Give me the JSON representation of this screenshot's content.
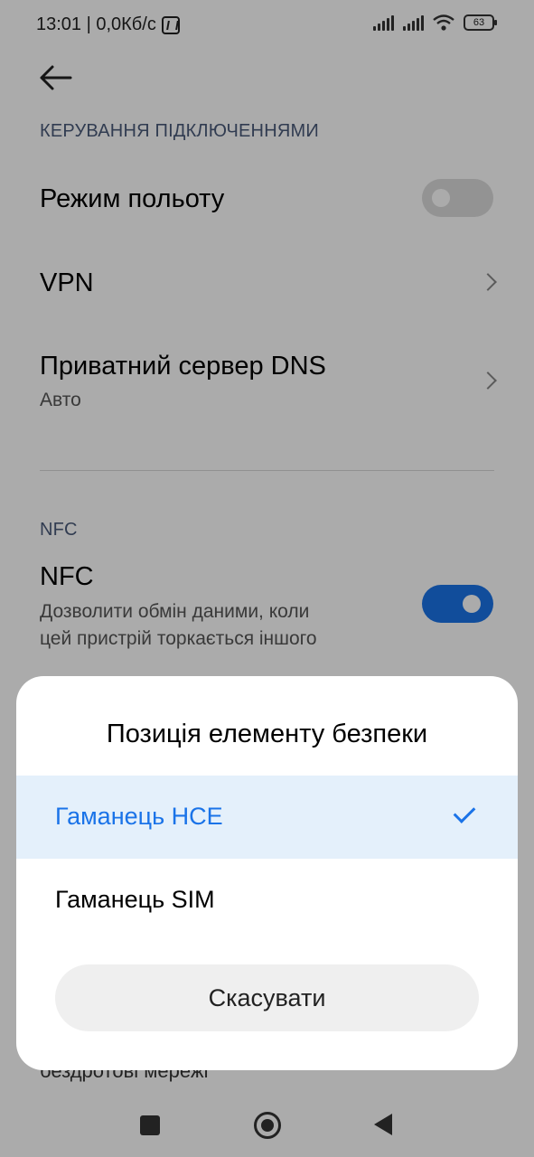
{
  "status_bar": {
    "time_speed": "13:01 | 0,0Кб/с",
    "nfc_icon": "nfc-icon",
    "battery": "63"
  },
  "header": {
    "back_icon": "arrow-left-icon"
  },
  "sections": {
    "connection_label": "КЕРУВАННЯ ПІДКЛЮЧЕННЯМИ",
    "airplane": {
      "title": "Режим польоту",
      "enabled": false
    },
    "vpn": {
      "title": "VPN"
    },
    "dns": {
      "title": "Приватний сервер DNS",
      "subtitle": "Авто"
    },
    "nfc_label": "NFC",
    "nfc": {
      "title": "NFC",
      "subtitle_line1": "Дозволити обмін даними, коли",
      "subtitle_line2": "цей пристрій торкається іншого",
      "enabled": true
    },
    "behind_text": "бездротові мережі"
  },
  "dialog": {
    "title": "Позиція елементу безпеки",
    "options": [
      {
        "label": "Гаманець HCE",
        "selected": true
      },
      {
        "label": "Гаманець SIM",
        "selected": false
      }
    ],
    "cancel_label": "Скасувати"
  },
  "colors": {
    "accent": "#1a73e8",
    "selected_bg": "#e4f0fb"
  }
}
